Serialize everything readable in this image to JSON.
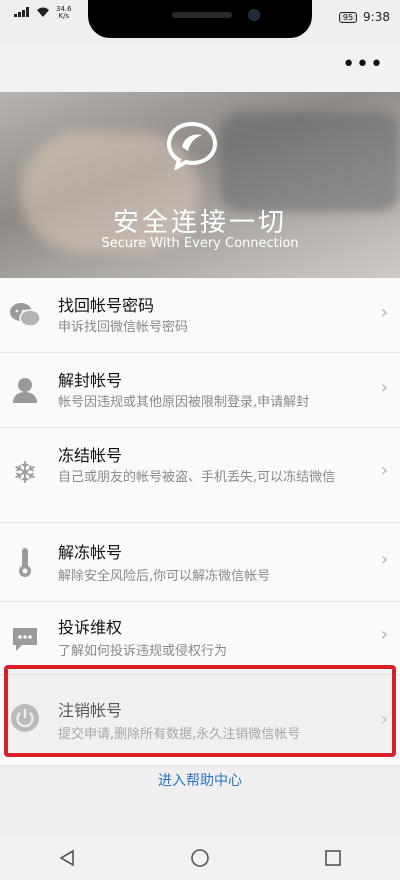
{
  "status_bar": {
    "speed_value": "34.6",
    "speed_unit": "K/s",
    "battery": "95",
    "time": "9:38"
  },
  "top_bar": {
    "more_label": "•••"
  },
  "hero": {
    "title": "安全连接一切",
    "subtitle": "Secure With Every Connection"
  },
  "items": [
    {
      "label": "找回帐号密码",
      "desc": "申诉找回微信帐号密码",
      "icon": "chat-bubbles-icon"
    },
    {
      "label": "解封帐号",
      "desc": "帐号因违规或其他原因被限制登录,申请解封",
      "icon": "person-icon"
    },
    {
      "label": "冻结帐号",
      "desc": "自己或朋友的帐号被盗、手机丢失,可以冻结微信",
      "icon": "snowflake-icon"
    },
    {
      "label": "解冻帐号",
      "desc": "解除安全风险后,你可以解冻微信帐号",
      "icon": "thermometer-icon"
    },
    {
      "label": "投诉维权",
      "desc": "了解如何投诉违规或侵权行为",
      "icon": "complaint-bubble-icon"
    },
    {
      "label": "注销帐号",
      "desc": "提交申请,删除所有数据,永久注销微信帐号",
      "icon": "power-icon"
    }
  ],
  "help_link": "进入帮助中心",
  "colors": {
    "highlight": "#d8202b",
    "link": "#2e74c8"
  }
}
